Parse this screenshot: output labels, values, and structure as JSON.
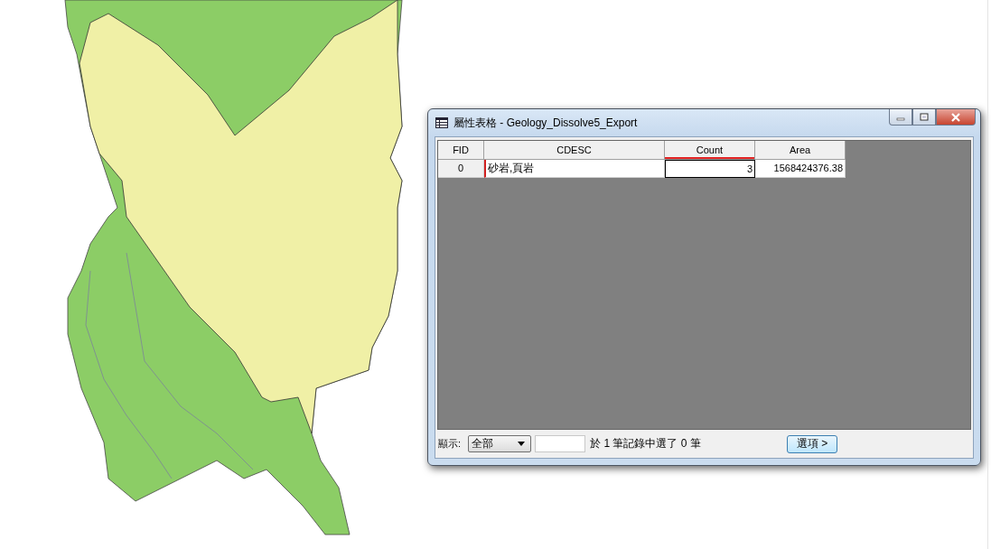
{
  "window": {
    "title": "屬性表格 - Geology_Dissolve5_Export"
  },
  "table": {
    "columns": [
      {
        "label": "FID",
        "selected": false
      },
      {
        "label": "CDESC",
        "selected": false
      },
      {
        "label": "Count",
        "selected": true
      },
      {
        "label": "Area",
        "selected": false
      }
    ],
    "rows": [
      {
        "cells": [
          {
            "text": "0",
            "selected": false
          },
          {
            "text": "砂岩,頁岩",
            "selected": false
          },
          {
            "text": "3",
            "selected": true
          },
          {
            "text": "1568424376.38",
            "selected": false
          }
        ]
      }
    ]
  },
  "footer": {
    "show_label": "顯示:",
    "show_dropdown": {
      "value": "全部"
    },
    "selection_status": "於 1 筆記錄中選了 0 筆",
    "options_button": "選項 >"
  }
}
